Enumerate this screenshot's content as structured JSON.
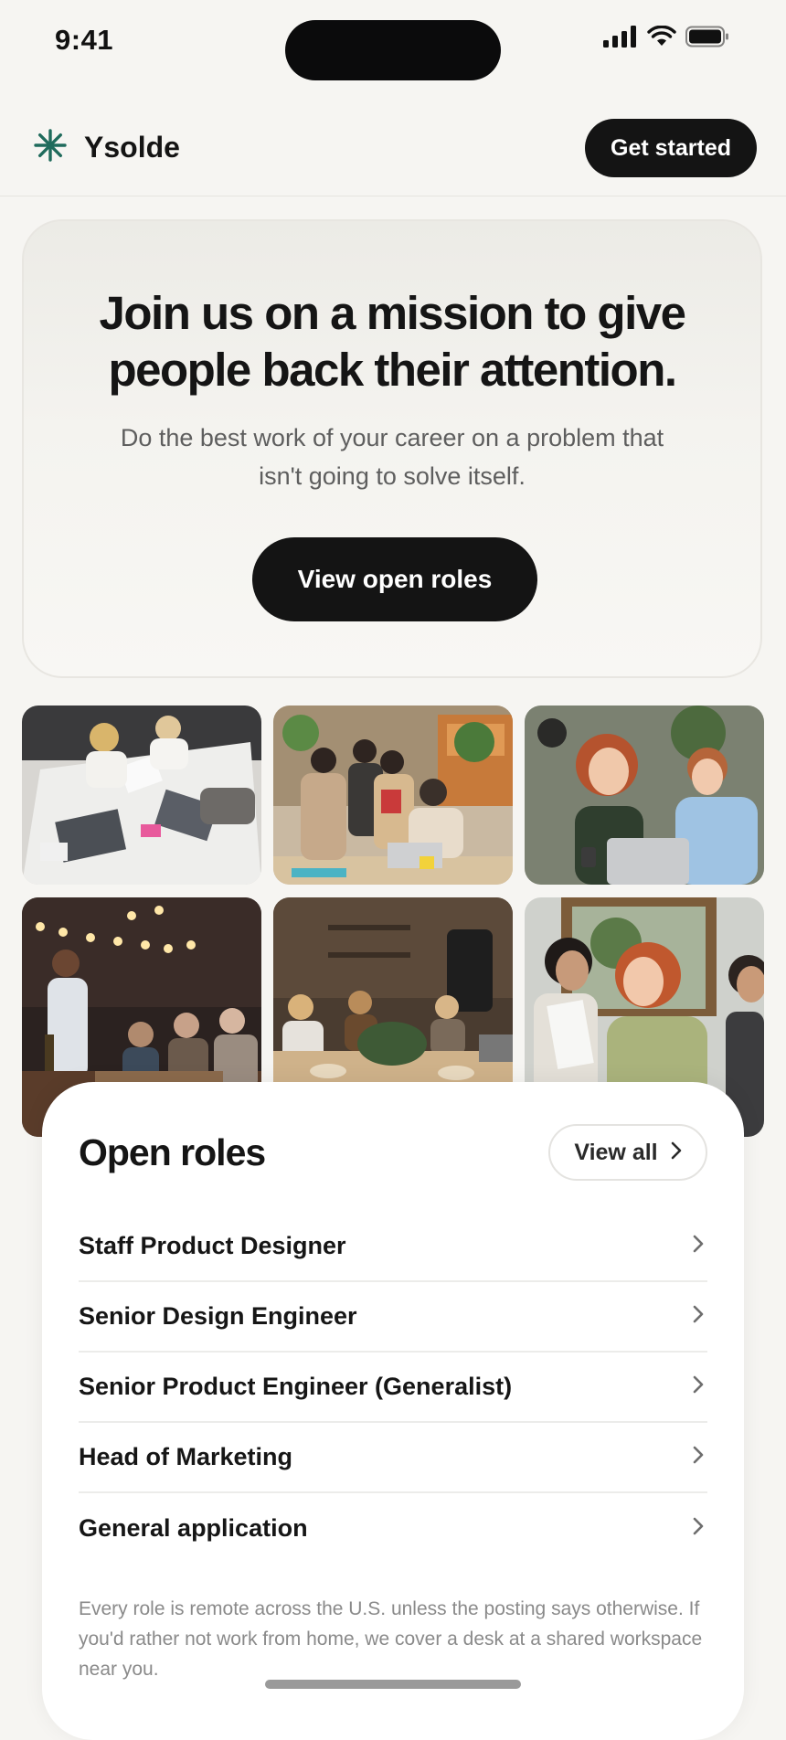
{
  "status_bar": {
    "time": "9:41"
  },
  "header": {
    "brand_name": "Ysolde",
    "cta_label": "Get started"
  },
  "hero": {
    "title": "Join us on a mission to give people back their attention.",
    "subtitle": "Do the best work of your career on a problem that isn't going to solve itself.",
    "button_label": "View open roles"
  },
  "open_roles": {
    "title": "Open roles",
    "view_all_label": "View all",
    "roles": [
      {
        "label": "Staff Product Designer"
      },
      {
        "label": "Senior Design Engineer"
      },
      {
        "label": "Senior Product Engineer (Generalist)"
      },
      {
        "label": "Head of Marketing"
      },
      {
        "label": "General application"
      }
    ],
    "note": "Every role is remote across the U.S. unless the posting says otherwise. If you'd rather not work from home, we cover a desk at a shared workspace near you."
  },
  "colors": {
    "accent_brand": "#1f6b5c",
    "button_dark": "#141414",
    "background": "#f6f5f2"
  },
  "icons": {
    "brand": "asterisk-logo-icon",
    "signal": "cellular-signal-icon",
    "wifi": "wifi-icon",
    "battery": "battery-icon",
    "row_chevron": "chevron-right-icon"
  }
}
